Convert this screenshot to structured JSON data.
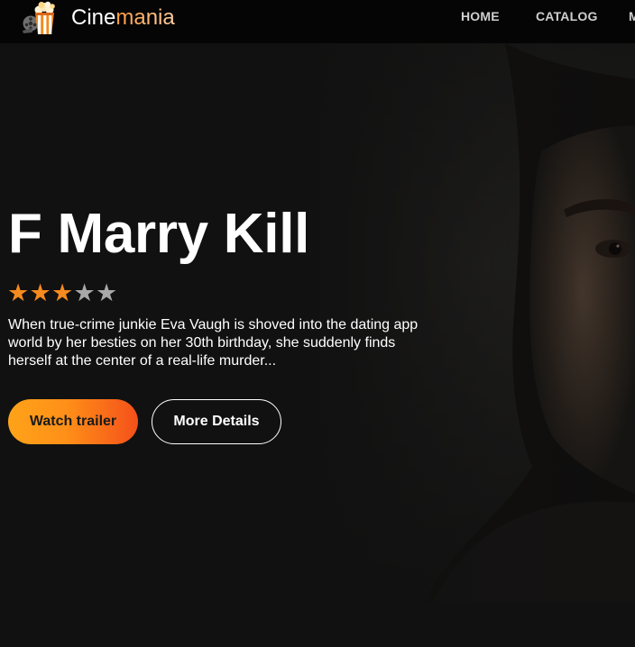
{
  "header": {
    "brand_prefix": "Cine",
    "brand_accent": "mania",
    "logo_icon": "popcorn-icon",
    "nav": [
      {
        "label": "HOME"
      },
      {
        "label": "CATALOG"
      },
      {
        "label": "M"
      }
    ]
  },
  "hero": {
    "title": "F Marry Kill",
    "rating": {
      "value": 3,
      "max": 5
    },
    "description": "When true-crime junkie Eva Vaugh is shoved into the dating app world by her besties on her 30th birthday, she suddenly finds herself at the center of a real-life murder...",
    "buttons": {
      "trailer": "Watch trailer",
      "details": "More Details"
    }
  },
  "colors": {
    "background": "#111111",
    "header_background": "#050505",
    "accent_orange": "#f58a1f",
    "star_inactive": "#a8a8a8",
    "button_gradient_start": "#ffa319",
    "button_gradient_end": "#f4501a"
  }
}
